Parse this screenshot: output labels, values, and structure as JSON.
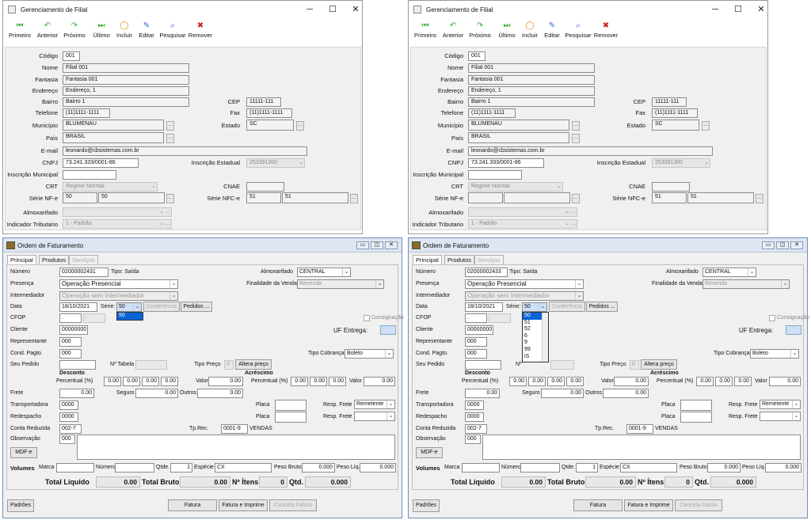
{
  "filial": {
    "title": "Gerenciamento de Filial",
    "toolbar": [
      "Primeiro",
      "Anterior",
      "Próximo",
      "Último",
      "Incluir",
      "Editar",
      "Pesquisar",
      "Remover"
    ],
    "labels": {
      "codigo": "Código",
      "nome": "Nome",
      "fantasia": "Fantasia",
      "endereco": "Endereço",
      "bairro": "Bairro",
      "telefone": "Telefone",
      "municipio": "Município",
      "pais": "País",
      "email": "E-mail",
      "cnpj": "CNPJ",
      "insc_mun": "Inscrição Municipal",
      "crt": "CRT",
      "serie_nfe": "Série NF-e",
      "almox": "Almoxarifado",
      "ind_trib": "Indicador Tributario",
      "cep": "CEP",
      "fax": "Fax",
      "estado": "Estado",
      "insc_est": "Inscrição Estadual",
      "cnae": "CNAE",
      "serie_nfce": "Série NFC-e"
    },
    "values": {
      "codigo": "001",
      "nome": "Filial 001",
      "fantasia": "Fantasia 001",
      "endereco": "Endereço, 1",
      "bairro": "Bairro 1",
      "telefone": "(11)1111-1111",
      "municipio": "BLUMENAU",
      "pais": "BRASIL",
      "email": "leonardo@cbsistemas.com.br",
      "cnpj": "73.241.333/0001-86",
      "crt": "Regime Normal",
      "serie_nfe_a": "50",
      "serie_nfe_b": "50",
      "cep": "11111-111",
      "fax": "(11)1111-1111",
      "estado": "SC",
      "insc_est": "253391300",
      "serie_nfce_a": "51",
      "serie_nfce_b": "51",
      "ind_trib": "1 - Padrão"
    },
    "values_right": {
      "serie_nfe_a": "",
      "serie_nfe_b": ""
    },
    "dots": "..."
  },
  "ordem": {
    "title": "Ordem de Faturamento",
    "tabs": [
      "Principal",
      "Produtos",
      "Serviços"
    ],
    "l": {
      "numero": "Número",
      "presenca": "Presença",
      "intermediador": "Intermediador",
      "data": "Data",
      "cfop": "CFOP",
      "cliente": "Cliente",
      "representante": "Representante",
      "cond_pagto": "Cond. Pagto.",
      "seu_pedido": "Seu Pedido",
      "desconto": "Desconto",
      "acrescimo": "Acréscimo",
      "percentual": "Percentual (%)",
      "valor": "Valor",
      "frete": "Frete",
      "seguro": "Seguro",
      "outros": "Outros",
      "transportadora": "Transportadora",
      "redespacho": "Redespacho",
      "conta_reduzida": "Conta Reduzida",
      "observacao": "Observação",
      "volumes": "Volumes",
      "marca": "Marca",
      "numero2": "Número",
      "qtde": "Qtde.",
      "especie": "Espécie",
      "peso_bruto": "Peso Bruto",
      "peso_liq": "Peso Líq.",
      "almox": "Almoxarifado",
      "finalidade": "Finalidade da Venda",
      "serie": "Série:",
      "n_tabela": "Nº Tabela",
      "tipo_preco": "Tipo Preço",
      "consignacao": "Consignação",
      "uf_entrega": "UF Entrega:",
      "tipo_cobranca": "Tipo Cobrança",
      "placa": "Placa",
      "resp_frete": "Resp. Frete",
      "tp_rec": "Tp.Rec.",
      "total_liquido": "Total Líquido",
      "total_bruto": "Total Bruto",
      "n_itens": "Nº Ítens",
      "qtd": "Qtd."
    },
    "v": {
      "numero": "02000002431",
      "tipo": "Tipo: Saída",
      "numero_r": "02000002433",
      "presenca": "Operação Presencial",
      "intermediador": "Operação sem Intermediador",
      "data": "18/10/2021",
      "serie": "50",
      "cfop1": ".",
      "cfop2": ".",
      "cliente": "00000000",
      "representante": "000",
      "cond_pagto": "000",
      "tipo_preco": "0",
      "zero": "0.00",
      "transportadora": "0000",
      "redespacho": "0000",
      "conta_reduzida": "002-7",
      "observacao": "000",
      "qtde": "1",
      "especie": "CX",
      "peso": "0.000",
      "almox": "CENTRAL",
      "finalidade": "Revenda",
      "tipo_cobranca": "Boleto",
      "resp_frete1": "Remetente",
      "tp_rec_code": "0001-9",
      "tp_rec_name": "VENDAS",
      "total_liquido": "0.00",
      "total_bruto": "0.00",
      "n_itens": "0",
      "qtd": "0.000"
    },
    "buttons": {
      "conferencia": "Conferência",
      "pedidos": "Pedidos ...",
      "altera_preco": "Altera preço",
      "mdfe": "MDF-e",
      "padroes": "Padrões",
      "fatura": "Fatura",
      "fatura_imprime": "Fatura e Imprime",
      "cancela": "Cancela Fatura"
    },
    "dropdown_left": [
      "50"
    ],
    "dropdown_right": [
      "50",
      "51",
      "52",
      "6",
      "9",
      "99",
      "iS"
    ]
  },
  "colors": {
    "highlight": "#0a64d6",
    "uf_box": "#cde0f5"
  }
}
